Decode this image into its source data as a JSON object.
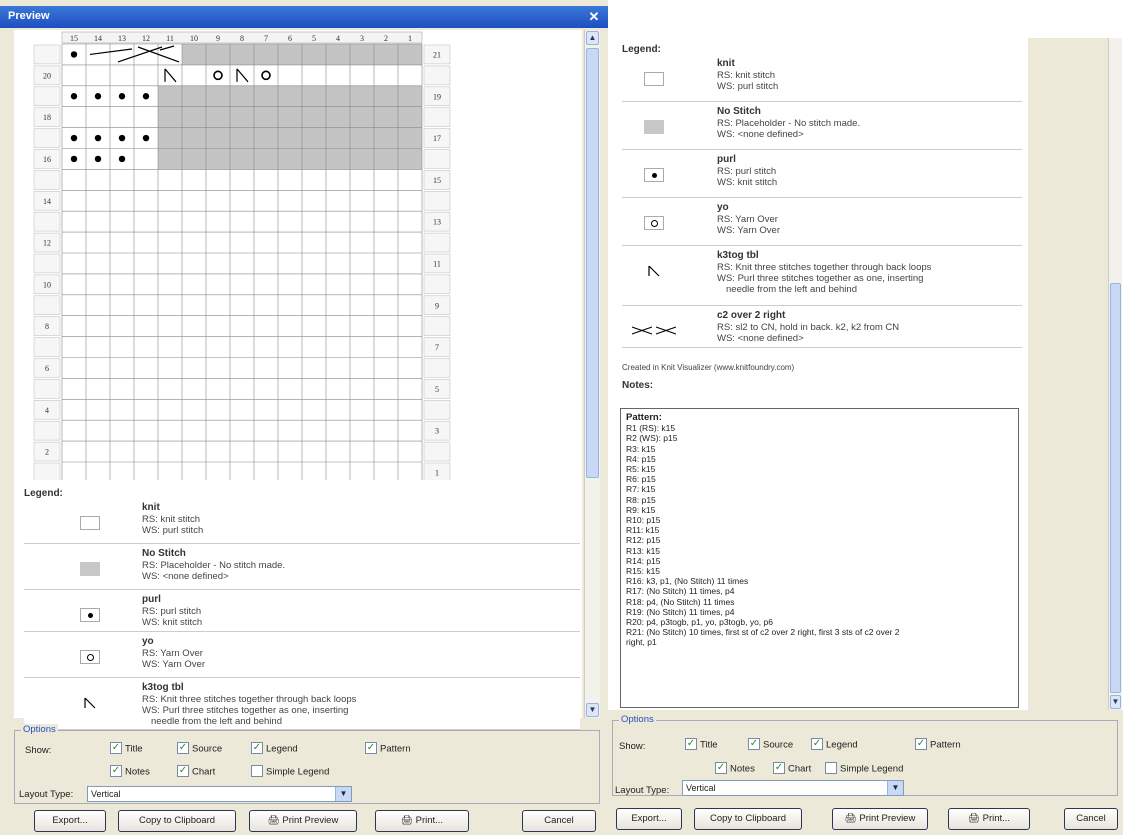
{
  "window": {
    "title": "Preview",
    "close_glyph": "✕"
  },
  "chart": {
    "col_numbers": [
      "15",
      "14",
      "13",
      "12",
      "11",
      "10",
      "9",
      "8",
      "7",
      "6",
      "5",
      "4",
      "3",
      "2",
      "1"
    ],
    "right_rows": [
      "21",
      "19",
      "17",
      "15",
      "13",
      "11",
      "9",
      "7",
      "5",
      "3",
      "1"
    ],
    "left_rows": [
      "20",
      "18",
      "16",
      "14",
      "12",
      "10",
      "8",
      "6",
      "4",
      "2"
    ]
  },
  "legend": {
    "title": "Legend:",
    "items": [
      {
        "name": "knit",
        "rs": "RS: knit stitch",
        "ws": "WS: purl stitch",
        "symbol": "knit-symbol"
      },
      {
        "name": "No Stitch",
        "rs": "RS: Placeholder - No stitch made.",
        "ws": "WS: <none defined>",
        "symbol": "no-stitch-symbol"
      },
      {
        "name": "purl",
        "rs": "RS: purl stitch",
        "ws": "WS: knit stitch",
        "symbol": "purl-symbol"
      },
      {
        "name": "yo",
        "rs": "RS: Yarn Over",
        "ws": "WS: Yarn Over",
        "symbol": "yarn-over-symbol"
      },
      {
        "name": "k3tog tbl",
        "rs": "RS: Knit three stitches together through back loops",
        "ws": "WS: Purl three stitches together as one, inserting",
        "ws2": "needle from the left and behind",
        "symbol": "k3tog-tbl-symbol"
      },
      {
        "name": "c2 over 2 right",
        "rs": "RS: sl2 to CN, hold in back. k2, k2 from CN",
        "ws": "WS: <none defined>",
        "symbol": "cable-symbol"
      }
    ]
  },
  "credit": "Created in Knit Visualizer (www.knitfoundry.com)",
  "notes": {
    "title": "Notes:",
    "lines": [
      "Pattern:",
      "R1 (RS): k15",
      "R2 (WS): p15",
      "R3: k15",
      "R4: p15",
      "R5: k15",
      "R6: p15",
      "R7: k15",
      "R8: p15",
      "R9: k15",
      "R10: p15",
      "R11: k15",
      "R12: p15",
      "R13: k15",
      "R14: p15",
      "R15: k15",
      "R16: k3, p1, (No Stitch) 11 times",
      "R17: (No Stitch) 11 times, p4",
      "R18: p4, (No Stitch) 11 times",
      "R19: (No Stitch) 11 times, p4",
      "R20: p4, p3togb, p1, yo, p3togb, yo, p6",
      "R21: (No Stitch) 10 times, first st of c2 over 2 right, first 3 sts of c2 over 2",
      "right, p1"
    ]
  },
  "options": {
    "title": "Options",
    "show_label": "Show:",
    "title_cb": "Title",
    "source_cb": "Source",
    "legend_cb": "Legend",
    "pattern_cb": "Pattern",
    "notes_cb": "Notes",
    "chart_cb": "Chart",
    "simple_cb": "Simple Legend",
    "check": "✓",
    "layout_label": "Layout Type:",
    "layout_value": "Vertical"
  },
  "buttons": {
    "export": "Export...",
    "copy": "Copy to Clipboard",
    "preview": "Print Preview",
    "print": "Print...",
    "cancel": "Cancel"
  }
}
